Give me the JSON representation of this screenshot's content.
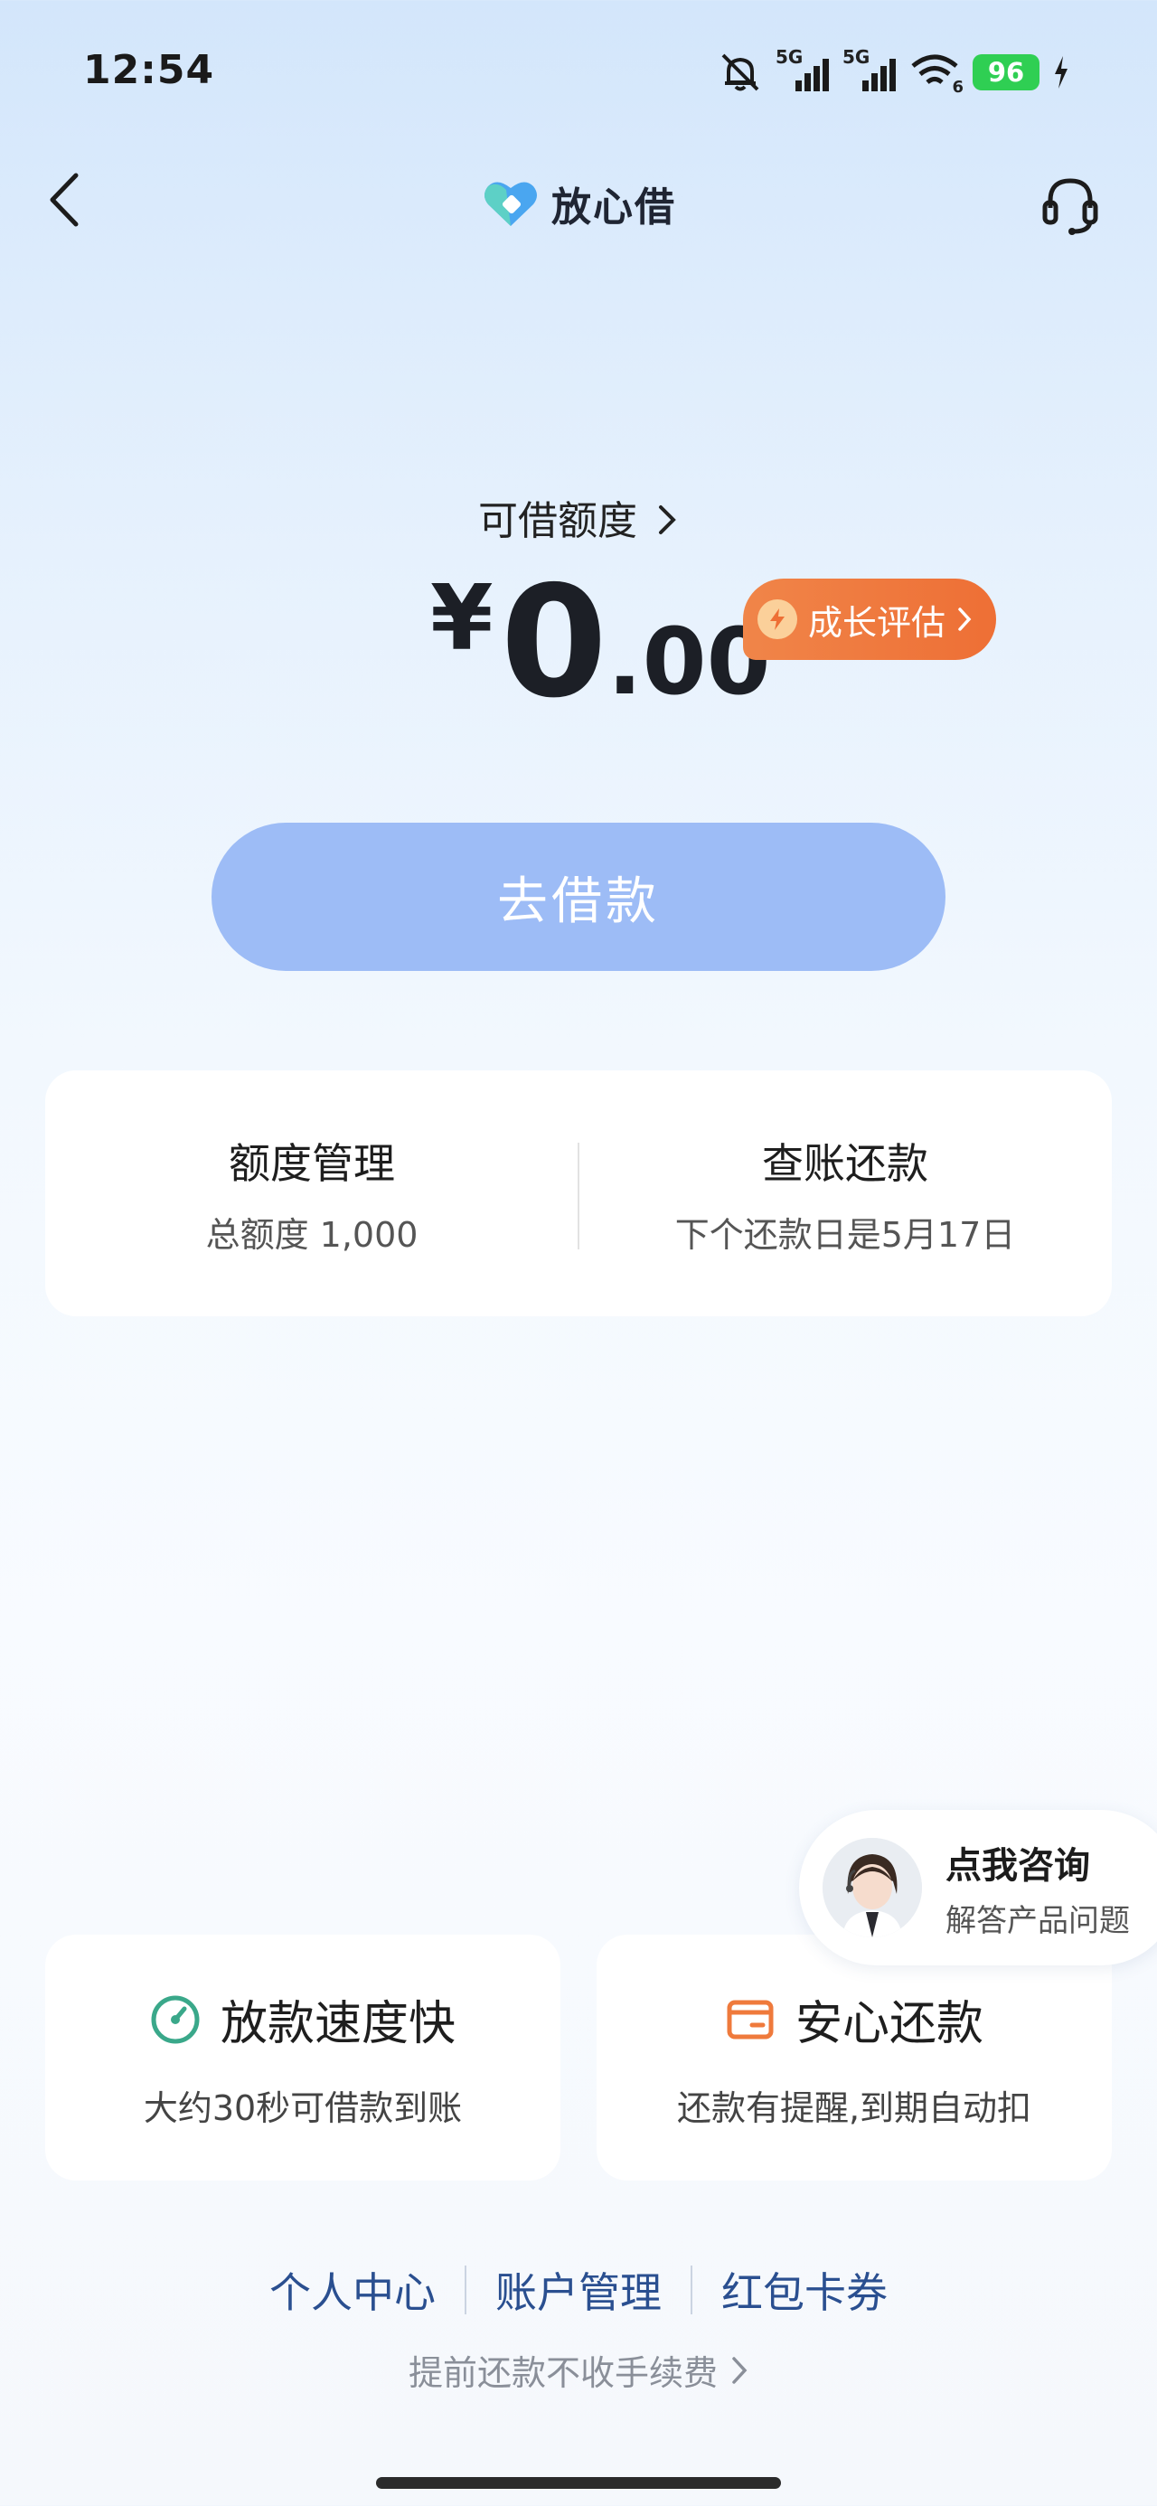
{
  "status_bar": {
    "time": "12:54",
    "network_1": "5G",
    "network_2": "5G",
    "wifi_sub": "6",
    "battery": "96"
  },
  "header": {
    "brand_name": "放心借"
  },
  "limit": {
    "label": "可借额度",
    "currency": "¥",
    "amount_int": "0",
    "amount_dec": ".00",
    "growth_badge": "成长评估"
  },
  "borrow_button": "去借款",
  "manage": {
    "left_title": "额度管理",
    "left_sub": "总额度 1,000",
    "right_title": "查账还款",
    "right_sub": "下个还款日是5月17日"
  },
  "consult": {
    "title": "点我咨询",
    "subtitle": "解答产品问题"
  },
  "features": [
    {
      "title": "放款速度快",
      "subtitle": "大约30秒可借款到账",
      "icon": "speed-gauge-icon"
    },
    {
      "title": "安心还款",
      "subtitle": "还款有提醒,到期自动扣",
      "icon": "wallet-card-icon"
    }
  ],
  "footer": {
    "links": [
      "个人中心",
      "账户管理",
      "红包卡券"
    ],
    "note": "提前还款不收手续费"
  },
  "colors": {
    "accent_blue": "#9dbcf6",
    "badge_orange": "#ee6f35",
    "link_blue": "#2a4f90",
    "feature_green": "#3aa88a",
    "feature_orange": "#ef7a3c"
  }
}
